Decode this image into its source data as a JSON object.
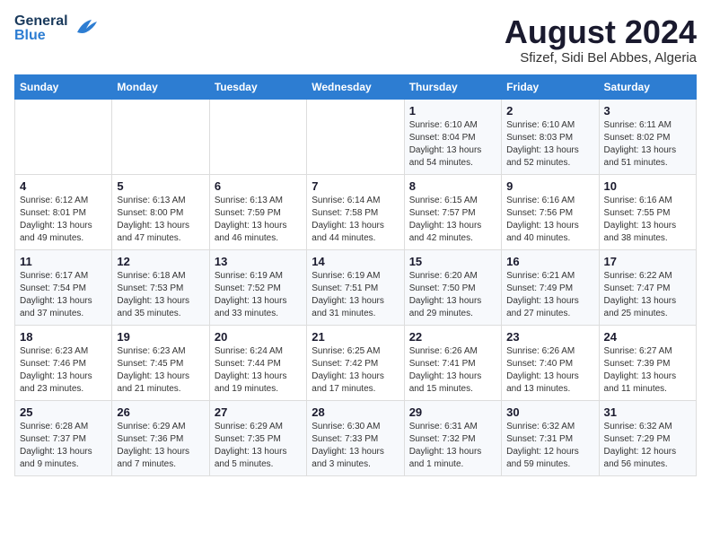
{
  "logo": {
    "line1": "General",
    "line2": "Blue"
  },
  "header": {
    "month_year": "August 2024",
    "location": "Sfizef, Sidi Bel Abbes, Algeria"
  },
  "days_of_week": [
    "Sunday",
    "Monday",
    "Tuesday",
    "Wednesday",
    "Thursday",
    "Friday",
    "Saturday"
  ],
  "weeks": [
    [
      {
        "day": "",
        "info": ""
      },
      {
        "day": "",
        "info": ""
      },
      {
        "day": "",
        "info": ""
      },
      {
        "day": "",
        "info": ""
      },
      {
        "day": "1",
        "info": "Sunrise: 6:10 AM\nSunset: 8:04 PM\nDaylight: 13 hours\nand 54 minutes."
      },
      {
        "day": "2",
        "info": "Sunrise: 6:10 AM\nSunset: 8:03 PM\nDaylight: 13 hours\nand 52 minutes."
      },
      {
        "day": "3",
        "info": "Sunrise: 6:11 AM\nSunset: 8:02 PM\nDaylight: 13 hours\nand 51 minutes."
      }
    ],
    [
      {
        "day": "4",
        "info": "Sunrise: 6:12 AM\nSunset: 8:01 PM\nDaylight: 13 hours\nand 49 minutes."
      },
      {
        "day": "5",
        "info": "Sunrise: 6:13 AM\nSunset: 8:00 PM\nDaylight: 13 hours\nand 47 minutes."
      },
      {
        "day": "6",
        "info": "Sunrise: 6:13 AM\nSunset: 7:59 PM\nDaylight: 13 hours\nand 46 minutes."
      },
      {
        "day": "7",
        "info": "Sunrise: 6:14 AM\nSunset: 7:58 PM\nDaylight: 13 hours\nand 44 minutes."
      },
      {
        "day": "8",
        "info": "Sunrise: 6:15 AM\nSunset: 7:57 PM\nDaylight: 13 hours\nand 42 minutes."
      },
      {
        "day": "9",
        "info": "Sunrise: 6:16 AM\nSunset: 7:56 PM\nDaylight: 13 hours\nand 40 minutes."
      },
      {
        "day": "10",
        "info": "Sunrise: 6:16 AM\nSunset: 7:55 PM\nDaylight: 13 hours\nand 38 minutes."
      }
    ],
    [
      {
        "day": "11",
        "info": "Sunrise: 6:17 AM\nSunset: 7:54 PM\nDaylight: 13 hours\nand 37 minutes."
      },
      {
        "day": "12",
        "info": "Sunrise: 6:18 AM\nSunset: 7:53 PM\nDaylight: 13 hours\nand 35 minutes."
      },
      {
        "day": "13",
        "info": "Sunrise: 6:19 AM\nSunset: 7:52 PM\nDaylight: 13 hours\nand 33 minutes."
      },
      {
        "day": "14",
        "info": "Sunrise: 6:19 AM\nSunset: 7:51 PM\nDaylight: 13 hours\nand 31 minutes."
      },
      {
        "day": "15",
        "info": "Sunrise: 6:20 AM\nSunset: 7:50 PM\nDaylight: 13 hours\nand 29 minutes."
      },
      {
        "day": "16",
        "info": "Sunrise: 6:21 AM\nSunset: 7:49 PM\nDaylight: 13 hours\nand 27 minutes."
      },
      {
        "day": "17",
        "info": "Sunrise: 6:22 AM\nSunset: 7:47 PM\nDaylight: 13 hours\nand 25 minutes."
      }
    ],
    [
      {
        "day": "18",
        "info": "Sunrise: 6:23 AM\nSunset: 7:46 PM\nDaylight: 13 hours\nand 23 minutes."
      },
      {
        "day": "19",
        "info": "Sunrise: 6:23 AM\nSunset: 7:45 PM\nDaylight: 13 hours\nand 21 minutes."
      },
      {
        "day": "20",
        "info": "Sunrise: 6:24 AM\nSunset: 7:44 PM\nDaylight: 13 hours\nand 19 minutes."
      },
      {
        "day": "21",
        "info": "Sunrise: 6:25 AM\nSunset: 7:42 PM\nDaylight: 13 hours\nand 17 minutes."
      },
      {
        "day": "22",
        "info": "Sunrise: 6:26 AM\nSunset: 7:41 PM\nDaylight: 13 hours\nand 15 minutes."
      },
      {
        "day": "23",
        "info": "Sunrise: 6:26 AM\nSunset: 7:40 PM\nDaylight: 13 hours\nand 13 minutes."
      },
      {
        "day": "24",
        "info": "Sunrise: 6:27 AM\nSunset: 7:39 PM\nDaylight: 13 hours\nand 11 minutes."
      }
    ],
    [
      {
        "day": "25",
        "info": "Sunrise: 6:28 AM\nSunset: 7:37 PM\nDaylight: 13 hours\nand 9 minutes."
      },
      {
        "day": "26",
        "info": "Sunrise: 6:29 AM\nSunset: 7:36 PM\nDaylight: 13 hours\nand 7 minutes."
      },
      {
        "day": "27",
        "info": "Sunrise: 6:29 AM\nSunset: 7:35 PM\nDaylight: 13 hours\nand 5 minutes."
      },
      {
        "day": "28",
        "info": "Sunrise: 6:30 AM\nSunset: 7:33 PM\nDaylight: 13 hours\nand 3 minutes."
      },
      {
        "day": "29",
        "info": "Sunrise: 6:31 AM\nSunset: 7:32 PM\nDaylight: 13 hours\nand 1 minute."
      },
      {
        "day": "30",
        "info": "Sunrise: 6:32 AM\nSunset: 7:31 PM\nDaylight: 12 hours\nand 59 minutes."
      },
      {
        "day": "31",
        "info": "Sunrise: 6:32 AM\nSunset: 7:29 PM\nDaylight: 12 hours\nand 56 minutes."
      }
    ]
  ]
}
